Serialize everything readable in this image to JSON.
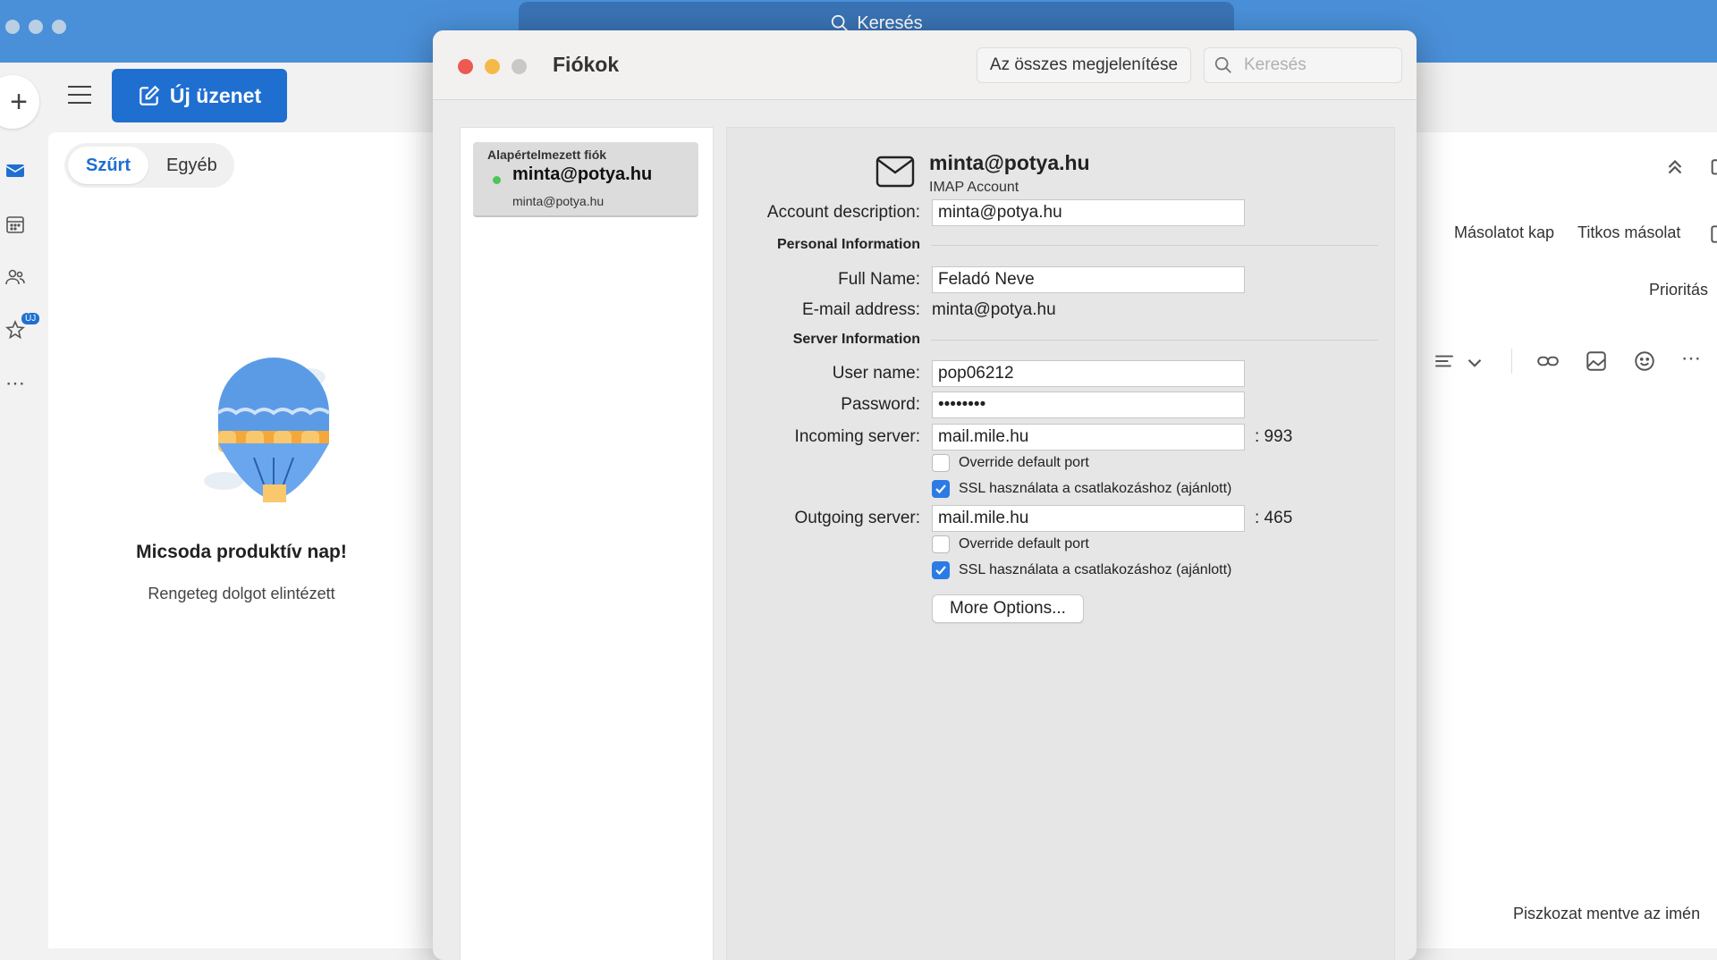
{
  "outlook": {
    "top_search": "Keresés",
    "new_message_label": "Új üzenet",
    "new_badge": "ÚJ",
    "filters": [
      "Szűrt",
      "Egyéb"
    ],
    "empty_title": "Micsoda produktív nap!",
    "empty_subtitle": "Rengeteg dolgot elintézett",
    "compose": {
      "cc_label": "Másolatot kap",
      "bcc_label": "Titkos másolat",
      "priority_label": "Prioritás",
      "draft_saved": "Piszkozat mentve az imén"
    }
  },
  "dialog": {
    "title": "Fiókok",
    "show_all_label": "Az összes megjelenítése",
    "search_placeholder": "Keresés",
    "account_list": {
      "group_label": "Alapértelmezett fiók",
      "name": "minta@potya.hu",
      "address": "minta@potya.hu"
    },
    "account": {
      "header_name": "minta@potya.hu",
      "header_type": "IMAP Account",
      "description_label": "Account description:",
      "description": "minta@potya.hu",
      "personal_section": "Personal Information",
      "full_name_label": "Full Name:",
      "full_name": "Feladó Neve",
      "email_label": "E-mail address:",
      "email": "minta@potya.hu",
      "server_section": "Server Information",
      "username_label": "User name:",
      "username": "pop06212",
      "password_label": "Password:",
      "password": "••••••••",
      "incoming_label": "Incoming server:",
      "incoming_server": "mail.mile.hu",
      "incoming_port": ": 993",
      "outgoing_label": "Outgoing server:",
      "outgoing_server": "mail.mile.hu",
      "outgoing_port": ": 465",
      "override_label": "Override default port",
      "ssl_label": "SSL használata a csatlakozáshoz (ajánlott)",
      "more_options_label": "More Options..."
    }
  },
  "colors": {
    "accent": "#1f6fd1",
    "titlebar": "#4a90d9",
    "close": "#ee5a52",
    "minimize": "#f5b94a",
    "zoom": "#c8c8c8",
    "checkbox_on": "#2c7be5"
  }
}
